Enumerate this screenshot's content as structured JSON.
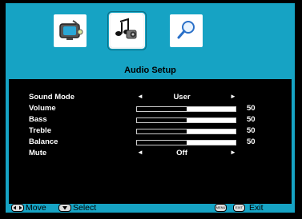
{
  "menu": {
    "tabs": [
      {
        "name": "picture",
        "icon": "tv-icon",
        "selected": false
      },
      {
        "name": "audio",
        "icon": "audio-icon",
        "selected": true
      },
      {
        "name": "search",
        "icon": "magnifier-icon",
        "selected": false
      }
    ],
    "title": "Audio Setup"
  },
  "settings": [
    {
      "label": "Sound Mode",
      "type": "select",
      "value": "User"
    },
    {
      "label": "Volume",
      "type": "slider",
      "value": 50,
      "max": 100
    },
    {
      "label": "Bass",
      "type": "slider",
      "value": 50,
      "max": 100
    },
    {
      "label": "Treble",
      "type": "slider",
      "value": 50,
      "max": 100
    },
    {
      "label": "Balance",
      "type": "slider",
      "value": 50,
      "max": 100
    },
    {
      "label": "Mute",
      "type": "select",
      "value": "Off"
    }
  ],
  "footer": {
    "move_label": "Move",
    "select_label": "Select",
    "menu_key": "MENU",
    "exit_key": "EXIT",
    "exit_label": "Exit"
  },
  "arrows": {
    "left": "◄",
    "right": "►"
  },
  "colors": {
    "panel": "#16a3c4",
    "background": "#000000",
    "text": "#ffffff"
  }
}
